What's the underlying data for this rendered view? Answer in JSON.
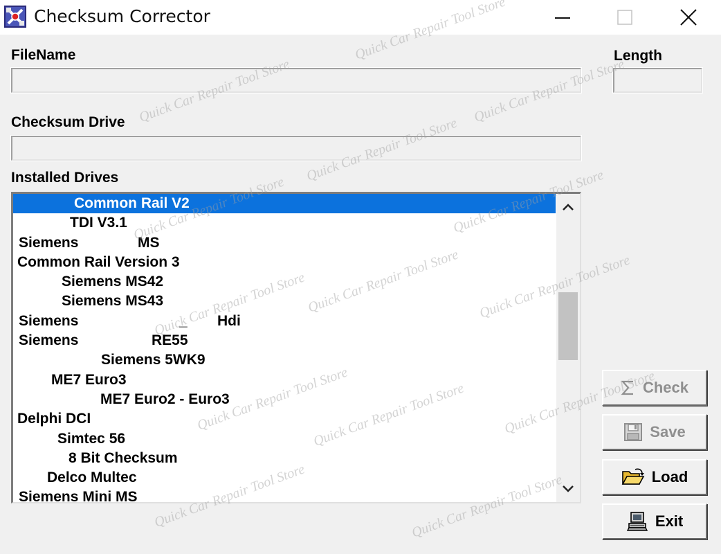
{
  "window": {
    "title": "Checksum Corrector"
  },
  "labels": {
    "filename": "FileName",
    "length": "Length",
    "checksum_drive": "Checksum Drive",
    "installed_drives": "Installed Drives"
  },
  "fields": {
    "filename": "",
    "length": "",
    "checksum_drive": ""
  },
  "drives": [
    {
      "parts": [
        {
          "text": "Common Rail V2",
          "indent": 88
        }
      ],
      "selected": true
    },
    {
      "parts": [
        {
          "text": "TDI V3.1",
          "indent": 82
        }
      ]
    },
    {
      "parts": [
        {
          "text": "Siemens",
          "indent": 8
        },
        {
          "text": "MS",
          "indent": 180
        }
      ]
    },
    {
      "parts": [
        {
          "text": "Common Rail Version 3",
          "indent": 6
        }
      ]
    },
    {
      "parts": [
        {
          "text": "Siemens MS42",
          "indent": 70
        }
      ]
    },
    {
      "parts": [
        {
          "text": "Siemens MS43",
          "indent": 70
        }
      ]
    },
    {
      "parts": [
        {
          "text": "Siemens",
          "indent": 8
        },
        {
          "text": "_",
          "indent": 240
        },
        {
          "text": "Hdi",
          "indent": 295
        }
      ]
    },
    {
      "parts": [
        {
          "text": "Siemens",
          "indent": 8
        },
        {
          "text": "RE55",
          "indent": 200
        }
      ]
    },
    {
      "parts": [
        {
          "text": "Siemens 5WK9",
          "indent": 127
        }
      ]
    },
    {
      "parts": [
        {
          "text": "ME7 Euro3",
          "indent": 55
        }
      ]
    },
    {
      "parts": [
        {
          "text": "ME7 Euro2 - Euro3",
          "indent": 126
        }
      ]
    },
    {
      "parts": [
        {
          "text": "Delphi DCI",
          "indent": 6
        }
      ]
    },
    {
      "parts": [
        {
          "text": "Simtec 56",
          "indent": 64
        }
      ]
    },
    {
      "parts": [
        {
          "text": "8 Bit Checksum",
          "indent": 80
        }
      ]
    },
    {
      "parts": [
        {
          "text": "Delco Multec",
          "indent": 49
        }
      ]
    },
    {
      "parts": [
        {
          "text": "Siemens Mini MS",
          "indent": 8
        }
      ]
    }
  ],
  "buttons": {
    "check": {
      "label": "Check",
      "icon": "sigma-icon",
      "enabled": false
    },
    "save": {
      "label": "Save",
      "icon": "floppy-disk-icon",
      "enabled": false
    },
    "load": {
      "label": "Load",
      "icon": "open-folder-icon",
      "enabled": true
    },
    "exit": {
      "label": "Exit",
      "icon": "computer-icon",
      "enabled": true
    }
  },
  "watermark": {
    "text": "Quick Car Repair Tool Store"
  },
  "colors": {
    "selection": "#0c72dd",
    "window_bg": "#f0f0f0",
    "disabled_text": "#8f8f8f"
  }
}
